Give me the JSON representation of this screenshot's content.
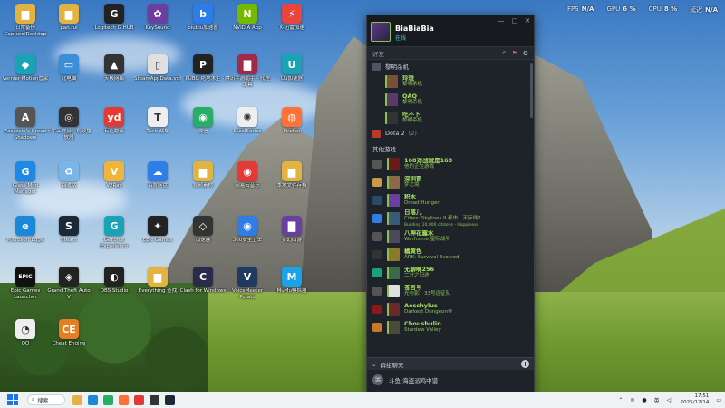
{
  "perf": {
    "fps_label": "FPS",
    "fps_value": "N/A",
    "gpu_label": "GPU",
    "gpu_value": "6 %",
    "cpu_label": "CPU",
    "cpu_value": "8 %",
    "latency_label": "延迟",
    "latency_value": "N/A"
  },
  "desktop_icons": [
    {
      "label": "日常备份\nCapture/Desktop",
      "color": "#e2b341",
      "glyph": "▆"
    },
    {
      "label": "pan.rui",
      "color": "#e2b341",
      "glyph": "▆"
    },
    {
      "label": "Logitech G HUB",
      "color": "#222",
      "glyph": "G"
    },
    {
      "label": "KeySound",
      "color": "#6b3fa0",
      "glyph": "✿"
    },
    {
      "label": "biubiu加速器",
      "color": "#2b7de9",
      "glyph": "b"
    },
    {
      "label": "NVIDIA App",
      "color": "#76b900",
      "glyph": "N"
    },
    {
      "label": "X-迅雷加速",
      "color": "#e8453c",
      "glyph": "⚡"
    },
    {
      "label": "Vernier-Motion管家",
      "color": "#1aa3b5",
      "glyph": "◆"
    },
    {
      "label": "此电脑",
      "color": "#3b8ed8",
      "glyph": "▭"
    },
    {
      "label": "天极网络",
      "color": "#333",
      "glyph": "▲"
    },
    {
      "label": "SteamAppData.vdf",
      "color": "#e0e0e0",
      "glyph": "▯"
    },
    {
      "label": "PUBG 绝地求生",
      "color": "#222",
      "glyph": "P"
    },
    {
      "label": "腾讯手游助手 - 代理工具",
      "color": "#a02a4a",
      "glyph": "▇"
    },
    {
      "label": "Uu加速器",
      "color": "#1aa3b5",
      "glyph": "U"
    },
    {
      "label": "Assassin's Creed Shadows",
      "color": "#555",
      "glyph": "A"
    },
    {
      "label": "千牛工作台 - 视频播放器",
      "color": "#333",
      "glyph": "◎"
    },
    {
      "label": "有道翻译",
      "color": "#e53935",
      "glyph": "yd"
    },
    {
      "label": "Tank 战车",
      "color": "#eee",
      "glyph": "T"
    },
    {
      "label": "微信",
      "color": "#2aae67",
      "glyph": "◉"
    },
    {
      "label": "SteelSeries",
      "color": "#eee",
      "glyph": "✺"
    },
    {
      "label": "Firefox",
      "color": "#ff7139",
      "glyph": "◍"
    },
    {
      "label": "Glass Mod Manager",
      "color": "#1e88e5",
      "glyph": "G"
    },
    {
      "label": "回收站",
      "color": "#7ab5e8",
      "glyph": "♻"
    },
    {
      "label": "V2Ray",
      "color": "#f0b43a",
      "glyph": "V"
    },
    {
      "label": "百度网盘",
      "color": "#2f7ee8",
      "glyph": "☁"
    },
    {
      "label": "视频素材",
      "color": "#e2b341",
      "glyph": "▆"
    },
    {
      "label": "网易云音乐",
      "color": "#e53935",
      "glyph": "◉"
    },
    {
      "label": "本地文件存档",
      "color": "#e2b341",
      "glyph": "▆"
    },
    {
      "label": "Microsoft Edge",
      "color": "#1b88d8",
      "glyph": "e"
    },
    {
      "label": "Steam",
      "color": "#1b2838",
      "glyph": "S"
    },
    {
      "label": "GeForce Experience",
      "color": "#1aa3b5",
      "glyph": "G"
    },
    {
      "label": "Epic Games",
      "color": "#222",
      "glyph": "✦"
    },
    {
      "label": "加速器",
      "color": "#333",
      "glyph": "◇"
    },
    {
      "label": "360安全卫士",
      "color": "#2f7ee8",
      "glyph": "◉"
    },
    {
      "label": "梦幻西游",
      "color": "#6b3fa0",
      "glyph": "▇"
    },
    {
      "label": "Epic Games Launcher",
      "color": "#111",
      "glyph": "EPIC"
    },
    {
      "label": "Grand Theft Auto V",
      "color": "#222",
      "glyph": "◈"
    },
    {
      "label": "OBS Studio",
      "color": "#222",
      "glyph": "◐"
    },
    {
      "label": "Everything 查找",
      "color": "#e2b341",
      "glyph": "▆"
    },
    {
      "label": "Clash for Windows",
      "color": "#2a2a4a",
      "glyph": "C"
    },
    {
      "label": "VoiceMeeter Potato",
      "color": "#1e3a5f",
      "glyph": "V"
    },
    {
      "label": "MuMu模拟器",
      "color": "#1aa3e8",
      "glyph": "M"
    },
    {
      "label": "QQ",
      "color": "#eee",
      "glyph": "◔"
    },
    {
      "label": "Cheat Engine",
      "color": "#e67e22",
      "glyph": "CE"
    }
  ],
  "steam": {
    "username": "BiaBiaBia",
    "status": "在线",
    "window_controls": {
      "minimize": "—",
      "maximize": "▢",
      "close": "✕"
    },
    "search_label": "好友",
    "groups": [
      {
        "name": "黎明杀机",
        "count": "",
        "color": "#4c5563",
        "friends": [
          {
            "name": "玲珑",
            "game": "黎明杀机",
            "avatar": "#7a4f3a"
          },
          {
            "name": "QAQ",
            "game": "黎明杀机",
            "avatar": "#5a3a6a"
          },
          {
            "name": "吃不下",
            "game": "黎明杀机",
            "avatar": "#333"
          }
        ]
      },
      {
        "name": "Dota 2",
        "count": "(2)",
        "color": "#b53a2a",
        "friends": []
      }
    ],
    "ingame_title": "其他游戏",
    "ingame": [
      {
        "name": "168对战就是168",
        "game": "他的正在游戏",
        "icon_color": "#555",
        "avatar": "#6a1a1a"
      },
      {
        "name": "深圳冒",
        "game": "梦之境",
        "icon_color": "#c89a45",
        "avatar": "#8a6a4a"
      },
      {
        "name": "积木",
        "game": "Dread Hunger",
        "icon_color": "#2a4a6a",
        "avatar": "#6b3fa0"
      },
      {
        "name": "日落儿",
        "game": "Cities: Skylines II 都市：天际线2",
        "game2": "Building 10,000 citizens - Happiness",
        "icon_color": "#2f7ee8",
        "avatar": "#3a5a7a"
      },
      {
        "name": "八神花露水",
        "game": "Warframe 星际战甲",
        "icon_color": "#555",
        "avatar": "#4a4a5a"
      },
      {
        "name": "橘黄色",
        "game": "ARK: Survival Evolved",
        "icon_color": "#333",
        "avatar": "#8a7a2a"
      },
      {
        "name": "无聊啊256",
        "game": "二分之归途",
        "icon_color": "#1aa37a",
        "avatar": "#3a6a4a"
      },
      {
        "name": "苍吾号",
        "game": "光与影：33号远征队",
        "icon_color": "#555",
        "avatar": "#e0e0e0"
      },
      {
        "name": "Aeschylus",
        "game": "Darkest Dungeon®",
        "icon_color": "#8a1a1a",
        "avatar": "#6a2a2a"
      },
      {
        "name": "Choushulin",
        "game": "Stardew Valley",
        "icon_color": "#c87a2a",
        "avatar": "#4a4a3a"
      }
    ],
    "chat_section": "群组聊天",
    "chats": [
      {
        "name": "斗鱼·海盗派鸡中谱",
        "icon": "⌘"
      }
    ]
  },
  "taskbar": {
    "search_placeholder": "搜索",
    "apps": [
      "#e2b341",
      "#1b88d8",
      "#2aae67",
      "#ff7139",
      "#e53935",
      "#333",
      "#1b2838"
    ],
    "tray_ime": "英",
    "time": "17:51",
    "date": "2025/12/14"
  }
}
